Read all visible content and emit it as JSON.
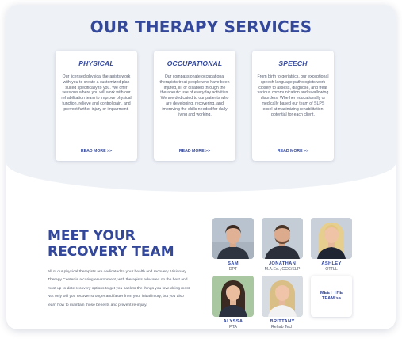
{
  "services": {
    "title": "OUR THERAPY SERVICES",
    "cards": [
      {
        "title": "PHYSICAL",
        "description": "Our licensed physical therapists work with you to create a customized plan suited specifically to you. We offer sessions where you will work with our rehabilitation team to improve physical function, relieve and control pain, and prevent further injury or impairment.",
        "link": "READ MORE >>"
      },
      {
        "title": "OCCUPATIONAL",
        "description": "Our compassionate occupational therapists treat people who have been injured, ill, or disabled through the therapeutic use of everyday activities. We are dedicated to our patients who are developing, recovering, and improving the skills needed for daily living and working.",
        "link": "READ MORE >>"
      },
      {
        "title": "SPEECH",
        "description": "From birth to geriatrics, our exceptional speech-language pathologists work closely to assess, diagnose, and treat various communication and swallowing disorders. Whether educationally or medically based our team of SLPS excel at maximizing rehabilitation potential for each client.",
        "link": "READ MORE >>"
      }
    ]
  },
  "team": {
    "heading_line1": "MEET YOUR",
    "heading_line2": "RECOVERY TEAM",
    "description": "All of our physical therapists are dedicated to your health and recovery. Visionary Therapy Center is a caring environment, with therapists educated on the best and most up-to-date recovery options to get you back to the things you love doing most! Not only will you recover stronger and faster from your initial injury, but you also learn how to maintain those benefits and prevent re-injury.",
    "members": [
      {
        "name": "SAM",
        "role": "DPT"
      },
      {
        "name": "JONATHAN",
        "role": "M.A.Ed., CCC/SLP"
      },
      {
        "name": "ASHLEY",
        "role": "OTR/L"
      },
      {
        "name": "ALYSSA",
        "role": "PTA"
      },
      {
        "name": "BRITTANY",
        "role": "Rehab Tech"
      }
    ],
    "meet_button": "MEET THE TEAM >>"
  },
  "colors": {
    "brand_blue": "#34489b",
    "band_background": "#eef1f6",
    "body_text": "#555d6e"
  }
}
